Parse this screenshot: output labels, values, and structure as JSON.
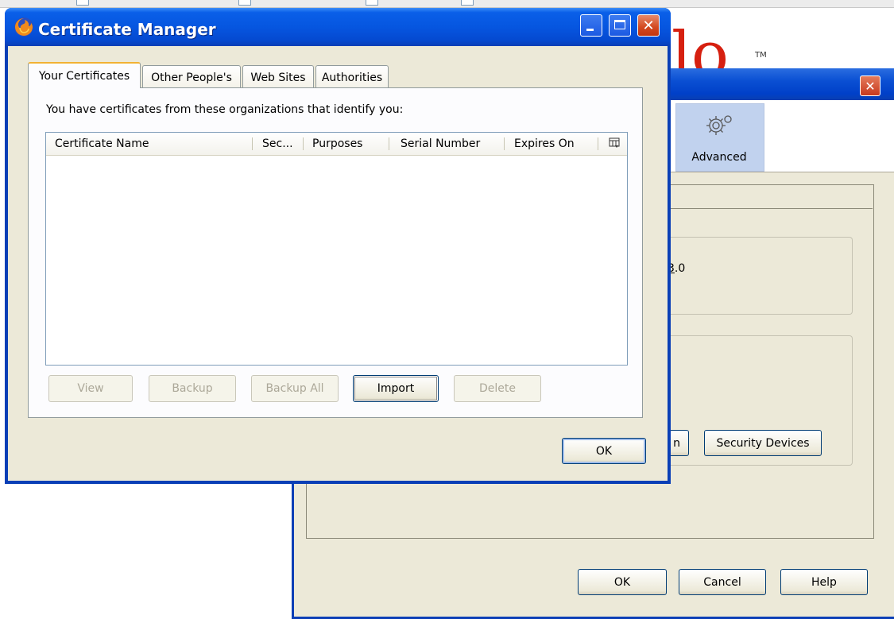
{
  "certificate_manager": {
    "title": "Certificate Manager",
    "tabs": [
      {
        "label": "Your Certificates",
        "selected": true
      },
      {
        "label": "Other People's",
        "selected": false
      },
      {
        "label": "Web Sites",
        "selected": false
      },
      {
        "label": "Authorities",
        "selected": false
      }
    ],
    "intro_text": "You have certificates from these organizations that identify you:",
    "table": {
      "columns": [
        "Certificate Name",
        "Sec...",
        "Purposes",
        "Serial Number",
        "Expires On"
      ],
      "rows": []
    },
    "buttons": {
      "view": "View",
      "backup": "Backup",
      "backup_all": "Backup All",
      "import": "Import",
      "delete": "Delete"
    },
    "ok_label": "OK",
    "colors": {
      "titlebar": "#0a5fe8",
      "close_button": "#d3481f",
      "active_tab_accent": "#f2b233"
    }
  },
  "options_window": {
    "close_glyph": "✕",
    "toolbar": {
      "advanced_label": "Advanced",
      "advanced_icon": "gear-icon"
    },
    "version_text_prefix": "3",
    "version_text_suffix": ".0",
    "partial_button_label": "n",
    "security_devices_label": "Security Devices",
    "ok_label": "OK",
    "cancel_label": "Cancel",
    "help_label": "Help"
  },
  "background_page": {
    "logo_visible_letters": "lo",
    "trademark": "TM"
  }
}
